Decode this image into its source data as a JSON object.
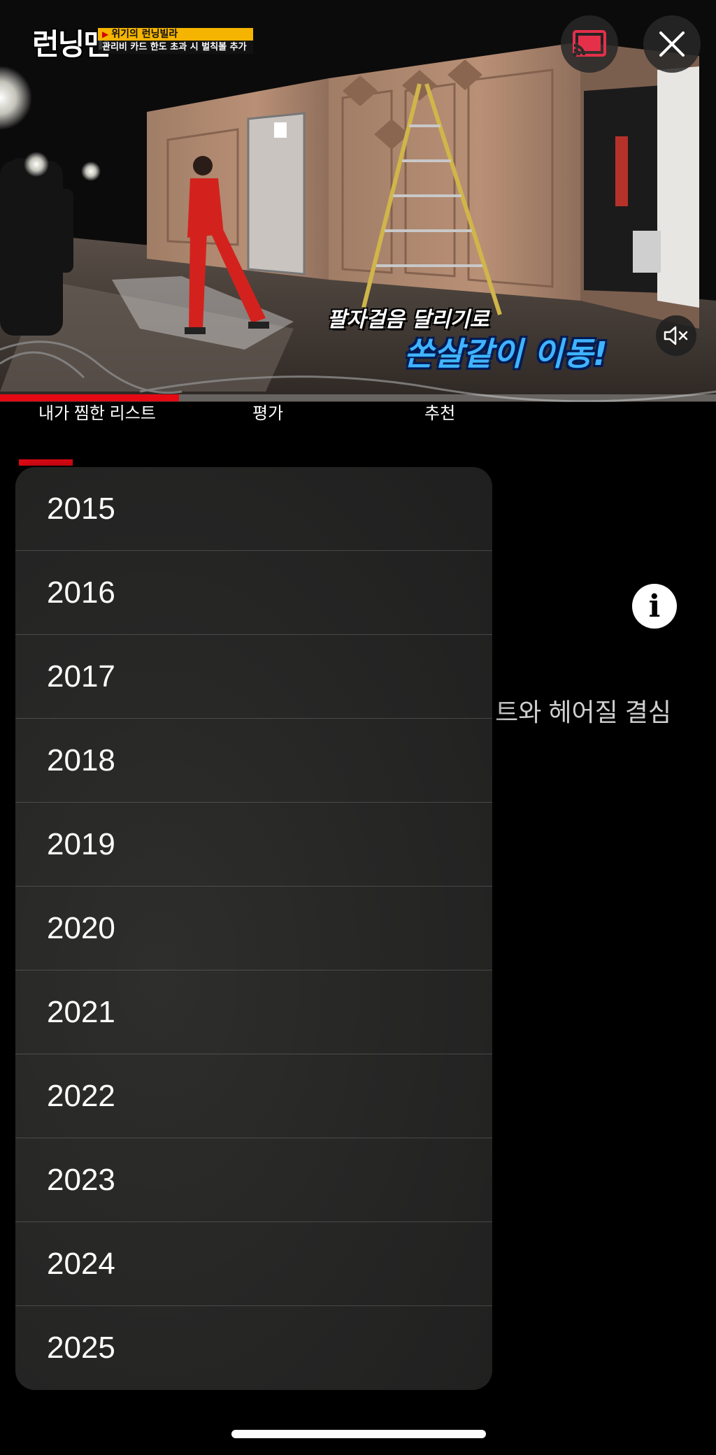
{
  "video": {
    "show_logo": "런닝맨",
    "caption_top": "위기의 런닝빌라",
    "caption_bottom": "관리비 카드 한도 초과 시 벌칙볼 추가",
    "subtitle_line1": "팔자걸음 달리기로",
    "subtitle_line2": "쏜살같이 이동!",
    "progress": 0.25
  },
  "tabs": [
    {
      "label": "내가 찜한 리스트",
      "selected": true
    },
    {
      "label": "평가"
    },
    {
      "label": "추천"
    }
  ],
  "background": {
    "text": "트와 헤어질 결심"
  },
  "year_menu": {
    "items": [
      "2015",
      "2016",
      "2017",
      "2018",
      "2019",
      "2020",
      "2021",
      "2022",
      "2023",
      "2024",
      "2025"
    ]
  },
  "colors": {
    "accent": "#e50914",
    "cast_icon": "#e5304a",
    "menu_bg": "#272726"
  },
  "icons": [
    "cast-icon",
    "close-icon",
    "mute-icon",
    "info-icon"
  ]
}
